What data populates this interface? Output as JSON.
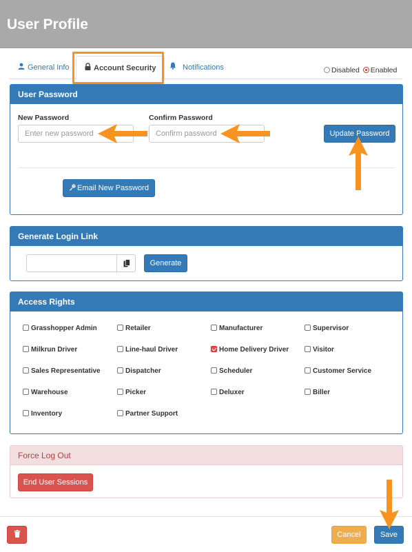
{
  "header": {
    "title": "User Profile"
  },
  "tabs": [
    {
      "label": "General Info",
      "icon": "user-icon"
    },
    {
      "label": "Account Security",
      "icon": "lock-icon"
    },
    {
      "label": "Notifications",
      "icon": "bell-icon"
    }
  ],
  "status": {
    "disabled_label": "Disabled",
    "enabled_label": "Enabled",
    "selected": "Enabled"
  },
  "user_password": {
    "heading": "User Password",
    "new_label": "New Password",
    "new_placeholder": "Enter new password",
    "confirm_label": "Confirm Password",
    "confirm_placeholder": "Confirm password",
    "update_button": "Update Password",
    "email_button": "Email New Password"
  },
  "login_link": {
    "heading": "Generate Login Link",
    "value": "",
    "generate_button": "Generate"
  },
  "access_rights": {
    "heading": "Access Rights",
    "items": [
      {
        "label": "Grasshopper Admin",
        "checked": false
      },
      {
        "label": "Retailer",
        "checked": false
      },
      {
        "label": "Manufacturer",
        "checked": false
      },
      {
        "label": "Supervisor",
        "checked": false
      },
      {
        "label": "Milkrun Driver",
        "checked": false
      },
      {
        "label": "Line-haul Driver",
        "checked": false
      },
      {
        "label": "Home Delivery Driver",
        "checked": true
      },
      {
        "label": "Visitor",
        "checked": false
      },
      {
        "label": "Sales Representative",
        "checked": false
      },
      {
        "label": "Dispatcher",
        "checked": false
      },
      {
        "label": "Scheduler",
        "checked": false
      },
      {
        "label": "Customer Service",
        "checked": false
      },
      {
        "label": "Warehouse",
        "checked": false
      },
      {
        "label": "Picker",
        "checked": false
      },
      {
        "label": "Deluxer",
        "checked": false
      },
      {
        "label": "Biller",
        "checked": false
      },
      {
        "label": "Inventory",
        "checked": false
      },
      {
        "label": "Partner Support",
        "checked": false
      }
    ]
  },
  "force_logout": {
    "heading": "Force Log Out",
    "button": "End User Sessions"
  },
  "footer": {
    "cancel_button": "Cancel",
    "save_button": "Save"
  },
  "colors": {
    "primary": "#337ab7",
    "danger": "#d9534f",
    "warning": "#f0ad4e",
    "annotation": "#f7931e",
    "header": "#a9a9a9"
  }
}
